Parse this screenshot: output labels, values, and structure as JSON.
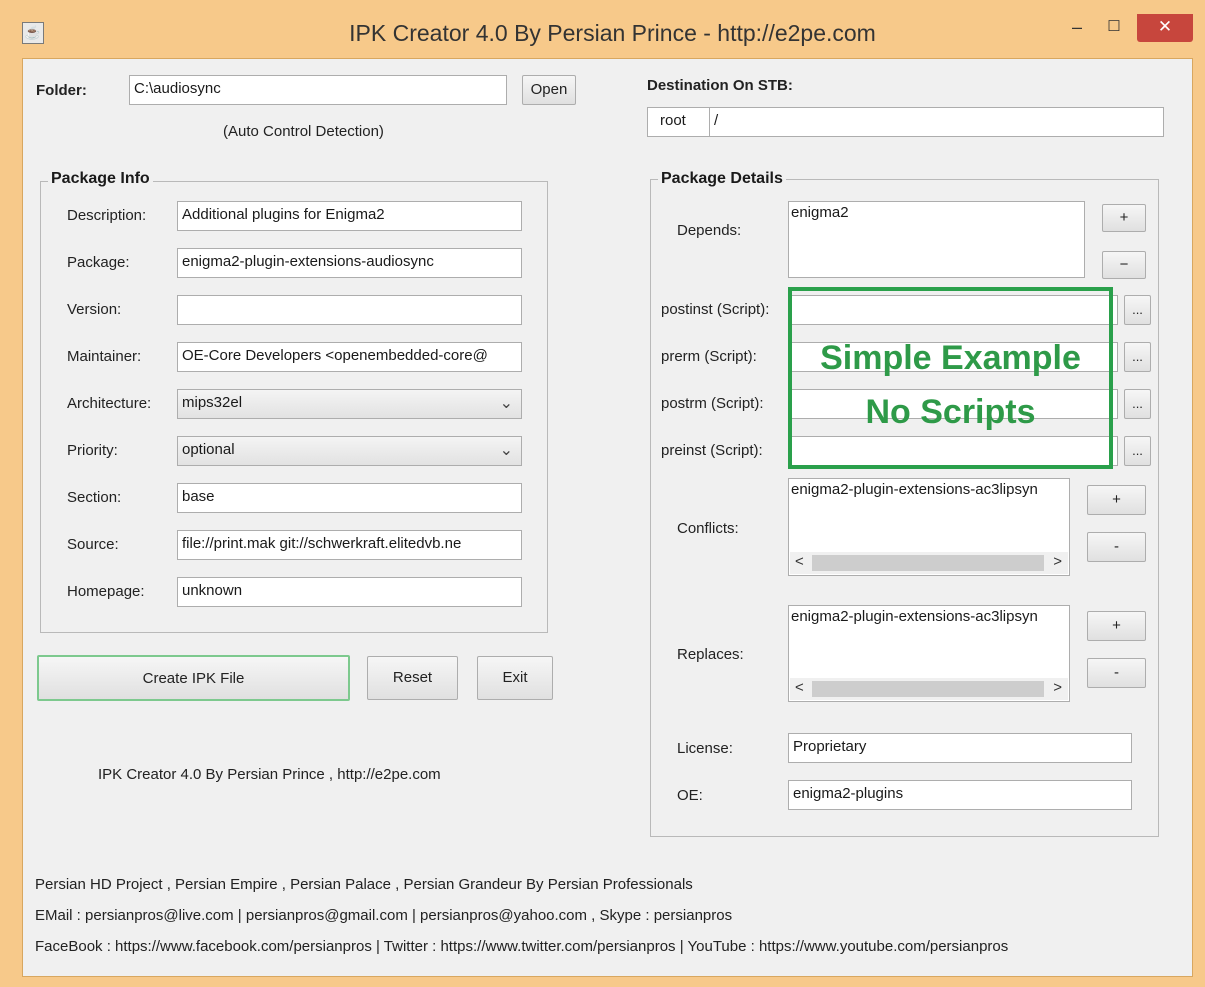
{
  "window": {
    "title": "IPK Creator 4.0 By Persian Prince - http://e2pe.com",
    "minimize_glyph": "‒",
    "maximize_glyph": "☐",
    "close_glyph": "✕",
    "app_icon": "java-icon"
  },
  "folder": {
    "label": "Folder:",
    "value": "C:\\audiosync",
    "open_button": "Open",
    "hint": "(Auto Control Detection)"
  },
  "destination": {
    "label": "Destination On STB:",
    "user": "root",
    "path": "/"
  },
  "package_info": {
    "title": "Package Info",
    "fields": {
      "description": {
        "label": "Description:",
        "value": "Additional plugins for Enigma2"
      },
      "package": {
        "label": "Package:",
        "value": "enigma2-plugin-extensions-audiosync"
      },
      "version": {
        "label": "Version:",
        "value": ""
      },
      "maintainer": {
        "label": "Maintainer:",
        "value": "OE-Core Developers <openembedded-core@"
      },
      "architecture": {
        "label": "Architecture:",
        "value": "mips32el"
      },
      "priority": {
        "label": "Priority:",
        "value": "optional"
      },
      "section": {
        "label": "Section:",
        "value": "base"
      },
      "source": {
        "label": "Source:",
        "value": "file://print.mak git://schwerkraft.elitedvb.ne"
      },
      "homepage": {
        "label": "Homepage:",
        "value": "unknown"
      }
    }
  },
  "actions": {
    "create": "Create IPK File",
    "reset": "Reset",
    "exit": "Exit",
    "credit": "IPK Creator 4.0 By Persian Prince , http://e2pe.com"
  },
  "package_details": {
    "title": "Package Details",
    "depends": {
      "label": "Depends:",
      "value": "enigma2",
      "add": "+",
      "remove": "−"
    },
    "postinst": {
      "label": "postinst (Script):",
      "browse": "..."
    },
    "prerm": {
      "label": "prerm (Script):",
      "browse": "..."
    },
    "postrm": {
      "label": "postrm (Script):",
      "browse": "..."
    },
    "preinst": {
      "label": "preinst (Script):",
      "browse": "..."
    },
    "conflicts": {
      "label": "Conflicts:",
      "value": "enigma2-plugin-extensions-ac3lipsyn",
      "add": "+",
      "remove": "-"
    },
    "replaces": {
      "label": "Replaces:",
      "value": "enigma2-plugin-extensions-ac3lipsyn",
      "add": "+",
      "remove": "-"
    },
    "license": {
      "label": "License:",
      "value": "Proprietary"
    },
    "oe": {
      "label": "OE:",
      "value": "enigma2-plugins"
    },
    "scroll_left": "<",
    "scroll_right": ">"
  },
  "annotation": {
    "line1": "Simple Example",
    "line2": "No Scripts",
    "color": "#2aa04b"
  },
  "footer": {
    "line1": "Persian HD Project , Persian Empire , Persian Palace , Persian Grandeur By Persian Professionals",
    "line2": "EMail : persianpros@live.com | persianpros@gmail.com | persianpros@yahoo.com , Skype : persianpros",
    "line3": "FaceBook : https://www.facebook.com/persianpros | Twitter : https://www.twitter.com/persianpros | YouTube : https://www.youtube.com/persianpros"
  }
}
